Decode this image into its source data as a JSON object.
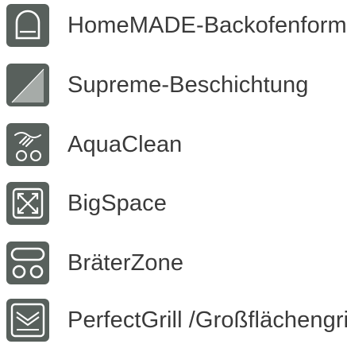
{
  "colors": {
    "icon_fill": "#58605c",
    "icon_line": "#ffffff",
    "text": "#3a3a3a"
  },
  "features": [
    {
      "label": "HomeMADE-Backofenform",
      "icon": "oven-mold-icon"
    },
    {
      "label": "Supreme-Beschichtung",
      "icon": "coating-icon"
    },
    {
      "label": "AquaClean",
      "icon": "aquaclean-icon"
    },
    {
      "label": "BigSpace",
      "icon": "bigspace-icon"
    },
    {
      "label": "BräterZone",
      "icon": "roaster-zone-icon"
    },
    {
      "label": "PerfectGrill /Großflächengrill",
      "icon": "perfectgrill-icon"
    }
  ]
}
